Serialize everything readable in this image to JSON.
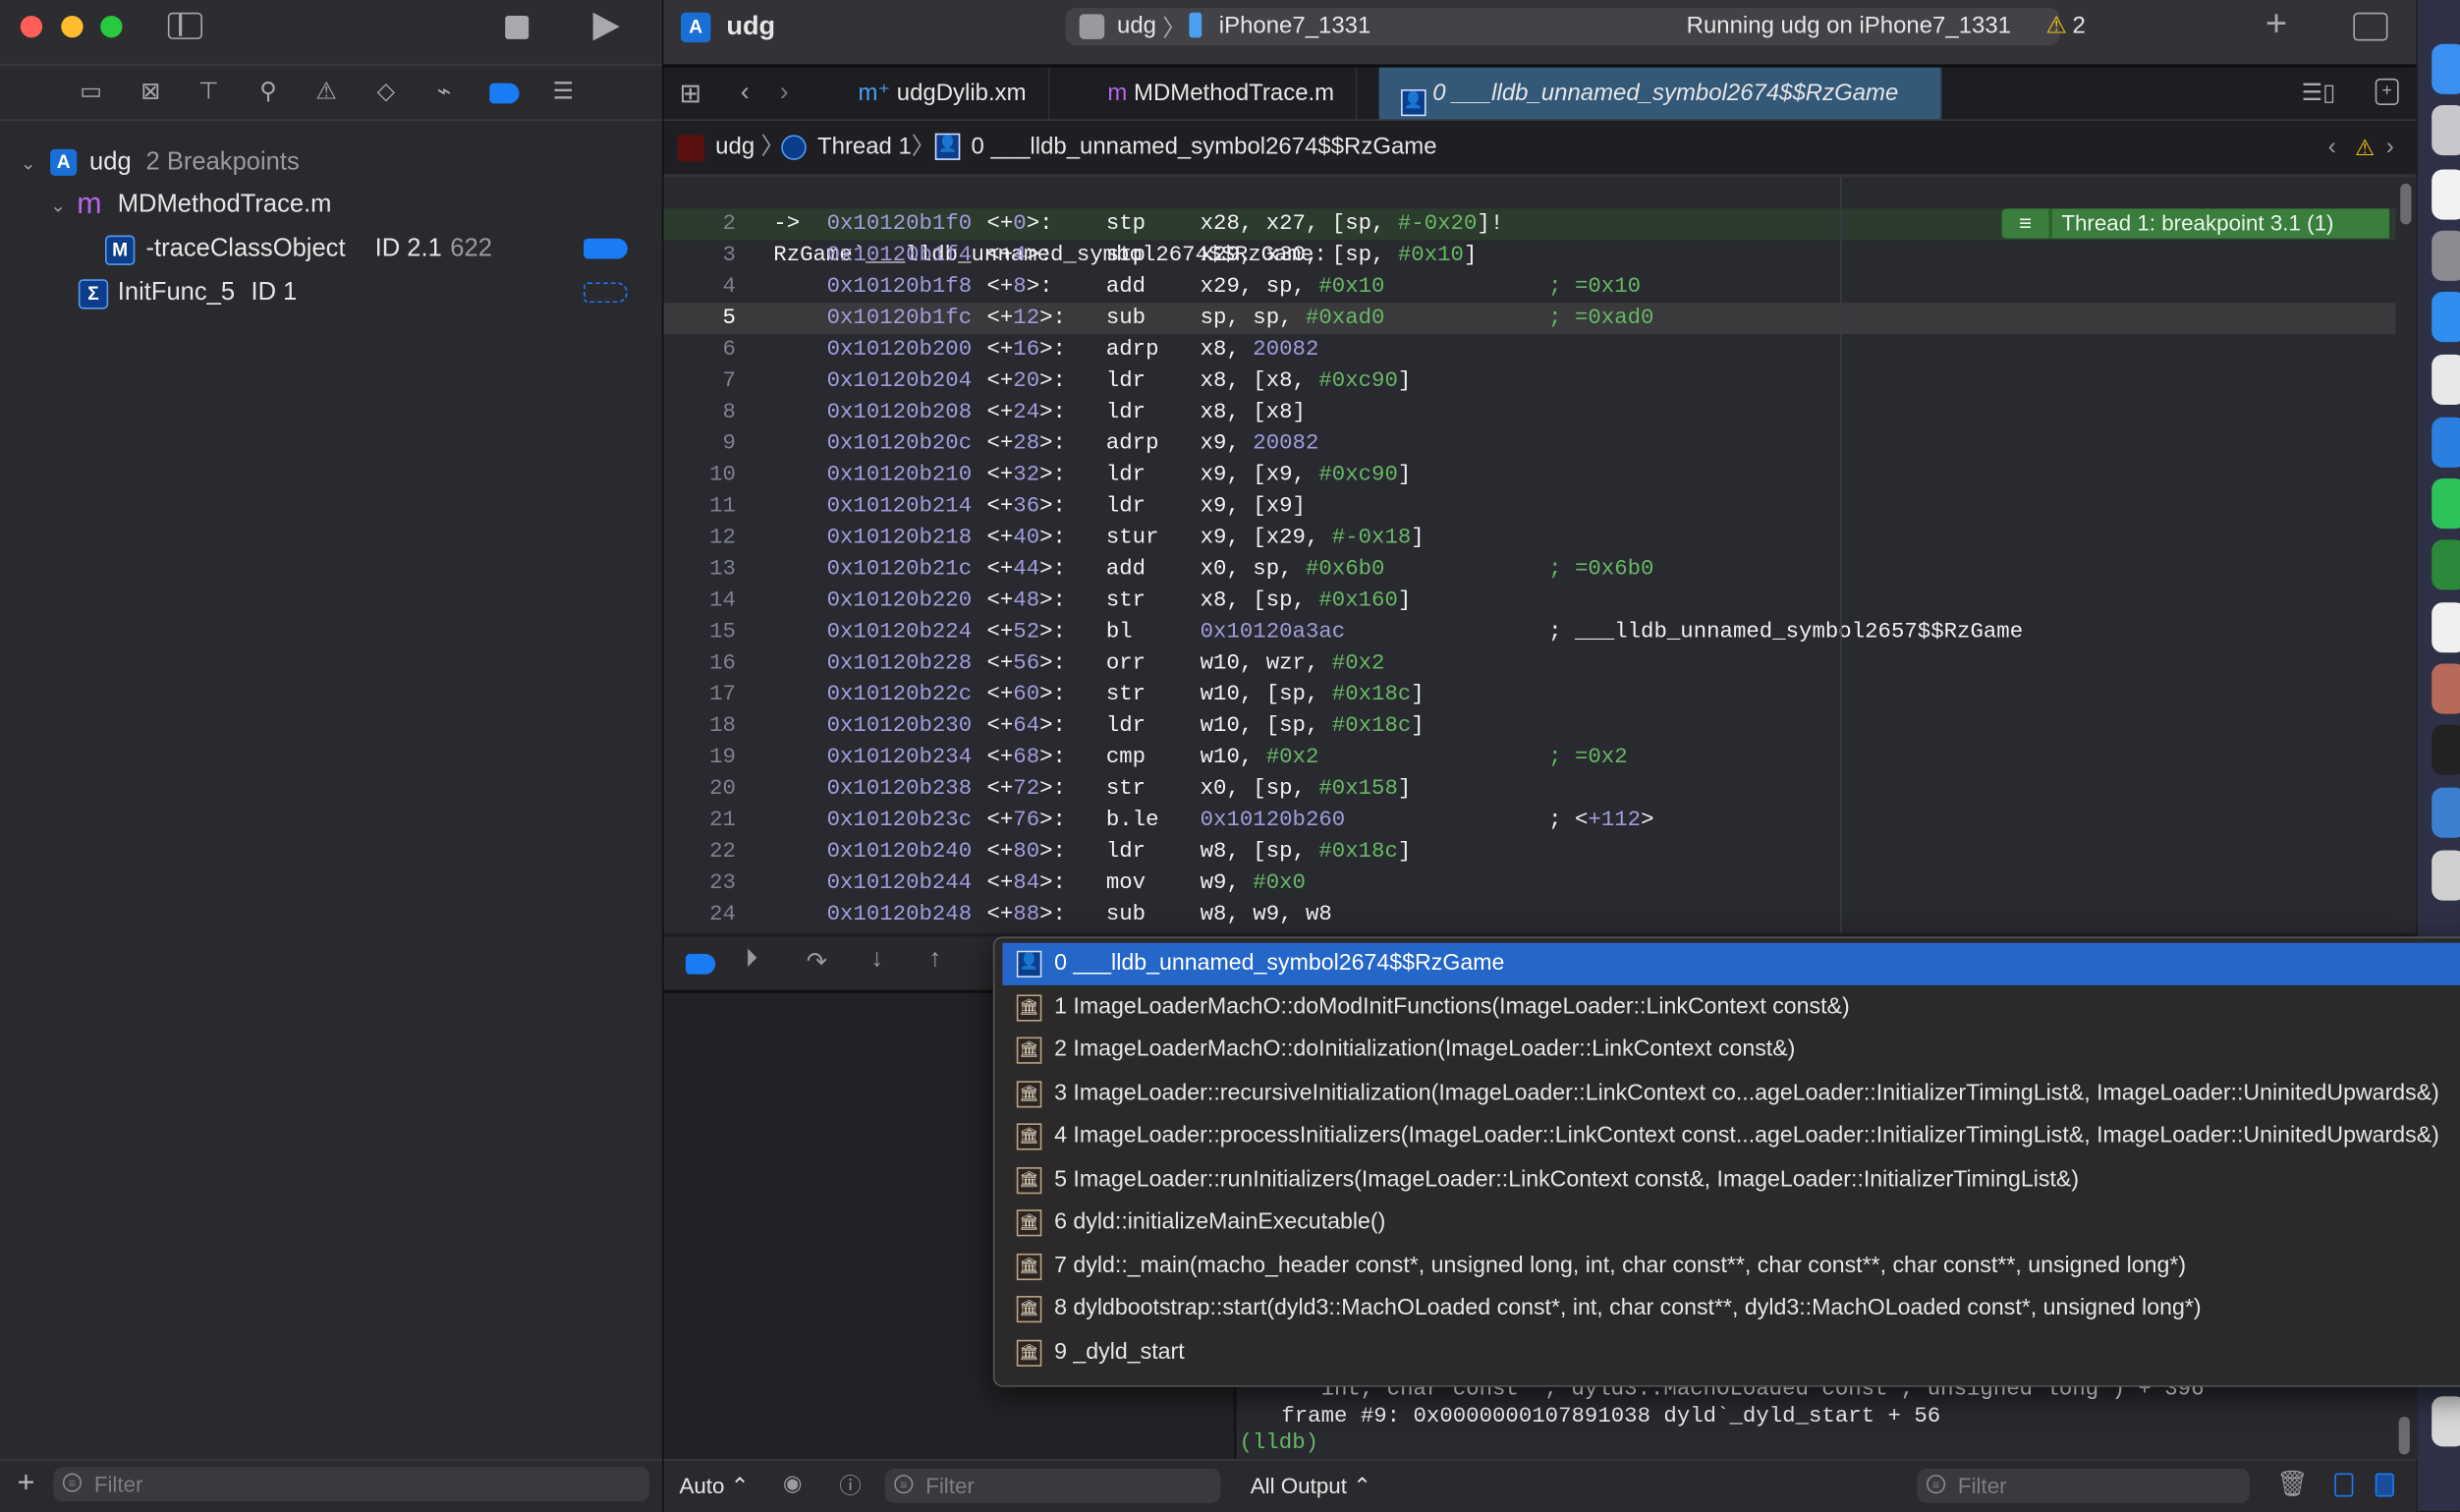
{
  "window": {
    "project_name": "udg",
    "scheme": "udg",
    "device": "iPhone7_1331",
    "status": "Running udg on iPhone7_1331",
    "warning_count": "2",
    "traffic_lights": {
      "close": "#ff5f57",
      "minimize": "#febc2e",
      "zoom": "#28c840"
    }
  },
  "navigator": {
    "icons": [
      "folder-icon",
      "source-control-icon",
      "symbol-icon",
      "search-icon",
      "issue-icon",
      "test-icon",
      "debug-icon",
      "breakpoint-icon",
      "report-icon"
    ],
    "root": {
      "name": "udg",
      "detail": "2 Breakpoints"
    },
    "file": {
      "name": "MDMethodTrace.m"
    },
    "breakpoints": [
      {
        "name": "-traceClassObject",
        "id": "ID 2.1",
        "line": "622",
        "enabled": true
      },
      {
        "name": "InitFunc_5",
        "id": "ID 1",
        "line": "",
        "enabled": false
      }
    ],
    "filter_placeholder": "Filter"
  },
  "tabs": [
    {
      "icon": "m+",
      "label": "udgDylib.xm",
      "active": false
    },
    {
      "icon": "m",
      "label": "MDMethodTrace.m",
      "active": false
    },
    {
      "icon": "frame",
      "label": "0 ___lldb_unnamed_symbol2674$$RzGame",
      "active": true
    }
  ],
  "breadcrumb": [
    "udg",
    "Thread 1",
    "0 ___lldb_unnamed_symbol2674$$RzGame"
  ],
  "code": {
    "header": "RzGame`___lldb_unnamed_symbol2674$$RzGame:",
    "current_line": 2,
    "highlight_line": 5,
    "breakpoint_annotation": "Thread 1: breakpoint 3.1 (1)",
    "lines": [
      {
        "n": "2",
        "arrow": "->",
        "addr": "0x10120b1f0",
        "off": "0",
        "mn": "stp",
        "ops": [
          [
            "x28, x27, [sp, ",
            "w"
          ],
          [
            "#-0x20",
            "imm"
          ],
          [
            "]!",
            "w"
          ]
        ],
        "cm": []
      },
      {
        "n": "3",
        "addr": "0x10120b1f4",
        "off": "4",
        "mn": "stp",
        "ops": [
          [
            "x29, x30, [sp, ",
            "w"
          ],
          [
            "#0x10",
            "imm"
          ],
          [
            "]",
            "w"
          ]
        ],
        "cm": []
      },
      {
        "n": "4",
        "addr": "0x10120b1f8",
        "off": "8",
        "mn": "add",
        "ops": [
          [
            "x29, sp, ",
            "w"
          ],
          [
            "#0x10",
            "imm"
          ]
        ],
        "cm": [
          [
            "; =0x10",
            "cm"
          ]
        ]
      },
      {
        "n": "5",
        "addr": "0x10120b1fc",
        "off": "12",
        "mn": "sub",
        "ops": [
          [
            "sp, sp, ",
            "w"
          ],
          [
            "#0xad0",
            "imm"
          ]
        ],
        "cm": [
          [
            "; =0xad0",
            "cm"
          ]
        ]
      },
      {
        "n": "6",
        "addr": "0x10120b200",
        "off": "16",
        "mn": "adrp",
        "ops": [
          [
            "x8, ",
            "w"
          ],
          [
            "20082",
            "num"
          ]
        ],
        "cm": []
      },
      {
        "n": "7",
        "addr": "0x10120b204",
        "off": "20",
        "mn": "ldr",
        "ops": [
          [
            "x8, [x8, ",
            "w"
          ],
          [
            "#0xc90",
            "imm"
          ],
          [
            "]",
            "w"
          ]
        ],
        "cm": []
      },
      {
        "n": "8",
        "addr": "0x10120b208",
        "off": "24",
        "mn": "ldr",
        "ops": [
          [
            "x8, [x8]",
            "w"
          ]
        ],
        "cm": []
      },
      {
        "n": "9",
        "addr": "0x10120b20c",
        "off": "28",
        "mn": "adrp",
        "ops": [
          [
            "x9, ",
            "w"
          ],
          [
            "20082",
            "num"
          ]
        ],
        "cm": []
      },
      {
        "n": "10",
        "addr": "0x10120b210",
        "off": "32",
        "mn": "ldr",
        "ops": [
          [
            "x9, [x9, ",
            "w"
          ],
          [
            "#0xc90",
            "imm"
          ],
          [
            "]",
            "w"
          ]
        ],
        "cm": []
      },
      {
        "n": "11",
        "addr": "0x10120b214",
        "off": "36",
        "mn": "ldr",
        "ops": [
          [
            "x9, [x9]",
            "w"
          ]
        ],
        "cm": []
      },
      {
        "n": "12",
        "addr": "0x10120b218",
        "off": "40",
        "mn": "stur",
        "ops": [
          [
            "x9, [x29, ",
            "w"
          ],
          [
            "#-0x18",
            "imm"
          ],
          [
            "]",
            "w"
          ]
        ],
        "cm": []
      },
      {
        "n": "13",
        "addr": "0x10120b21c",
        "off": "44",
        "mn": "add",
        "ops": [
          [
            "x0, sp, ",
            "w"
          ],
          [
            "#0x6b0",
            "imm"
          ]
        ],
        "cm": [
          [
            "; =0x6b0",
            "cm"
          ]
        ]
      },
      {
        "n": "14",
        "addr": "0x10120b220",
        "off": "48",
        "mn": "str",
        "ops": [
          [
            "x8, [sp, ",
            "w"
          ],
          [
            "#0x160",
            "imm"
          ],
          [
            "]",
            "w"
          ]
        ],
        "cm": []
      },
      {
        "n": "15",
        "addr": "0x10120b224",
        "off": "52",
        "mn": "bl",
        "ops": [
          [
            "0x10120a3ac",
            "num"
          ]
        ],
        "cm": [
          [
            "; ___lldb_unnamed_symbol2657$$RzGame",
            "w"
          ]
        ]
      },
      {
        "n": "16",
        "addr": "0x10120b228",
        "off": "56",
        "mn": "orr",
        "ops": [
          [
            "w10, wzr, ",
            "w"
          ],
          [
            "#0x2",
            "imm"
          ]
        ],
        "cm": []
      },
      {
        "n": "17",
        "addr": "0x10120b22c",
        "off": "60",
        "mn": "str",
        "ops": [
          [
            "w10, [sp, ",
            "w"
          ],
          [
            "#0x18c",
            "imm"
          ],
          [
            "]",
            "w"
          ]
        ],
        "cm": []
      },
      {
        "n": "18",
        "addr": "0x10120b230",
        "off": "64",
        "mn": "ldr",
        "ops": [
          [
            "w10, [sp, ",
            "w"
          ],
          [
            "#0x18c",
            "imm"
          ],
          [
            "]",
            "w"
          ]
        ],
        "cm": []
      },
      {
        "n": "19",
        "addr": "0x10120b234",
        "off": "68",
        "mn": "cmp",
        "ops": [
          [
            "w10, ",
            "w"
          ],
          [
            "#0x2",
            "imm"
          ]
        ],
        "cm": [
          [
            "; =0x2",
            "cm"
          ]
        ]
      },
      {
        "n": "20",
        "addr": "0x10120b238",
        "off": "72",
        "mn": "str",
        "ops": [
          [
            "x0, [sp, ",
            "w"
          ],
          [
            "#0x158",
            "imm"
          ],
          [
            "]",
            "w"
          ]
        ],
        "cm": []
      },
      {
        "n": "21",
        "addr": "0x10120b23c",
        "off": "76",
        "mn": "b.le",
        "ops": [
          [
            "0x10120b260",
            "num"
          ]
        ],
        "cm": [
          [
            "; <",
            "w"
          ],
          [
            "+112",
            "num"
          ],
          [
            ">",
            "w"
          ]
        ]
      },
      {
        "n": "22",
        "addr": "0x10120b240",
        "off": "80",
        "mn": "ldr",
        "ops": [
          [
            "w8, [sp, ",
            "w"
          ],
          [
            "#0x18c",
            "imm"
          ],
          [
            "]",
            "w"
          ]
        ],
        "cm": []
      },
      {
        "n": "23",
        "addr": "0x10120b244",
        "off": "84",
        "mn": "mov",
        "ops": [
          [
            "w9, ",
            "w"
          ],
          [
            "#0x0",
            "imm"
          ]
        ],
        "cm": []
      },
      {
        "n": "24",
        "addr": "0x10120b248",
        "off": "88",
        "mn": "sub",
        "ops": [
          [
            "w8, w9, w8",
            "w"
          ]
        ],
        "cm": []
      }
    ]
  },
  "stack_frames": [
    "0 ___lldb_unnamed_symbol2674$$RzGame",
    "1 ImageLoaderMachO::doModInitFunctions(ImageLoader::LinkContext const&)",
    "2 ImageLoaderMachO::doInitialization(ImageLoader::LinkContext const&)",
    "3 ImageLoader::recursiveInitialization(ImageLoader::LinkContext co...ageLoader::InitializerTimingList&, ImageLoader::UninitedUpwards&)",
    "4 ImageLoader::processInitializers(ImageLoader::LinkContext const...ageLoader::InitializerTimingList&, ImageLoader::UninitedUpwards&)",
    "5 ImageLoader::runInitializers(ImageLoader::LinkContext const&, ImageLoader::InitializerTimingList&)",
    "6 dyld::initializeMainExecutable()",
    "7 dyld::_main(macho_header const*, unsigned long, int, char const**, char const**, char const**, unsigned long*)",
    "8 dyldbootstrap::start(dyld3::MachOLoaded const*, int, char const**, dyld3::MachOLoaded const*, unsigned long*)",
    "9 _dyld_start"
  ],
  "console": {
    "lines": [
      "     int, char const**, dyld3::MachOLoaded const*, unsigned long*) + 396",
      "  frame #9: 0x0000000107891038 dyld`_dyld_start + 56"
    ],
    "prompt": "(lldb)"
  },
  "bottom": {
    "variables_scope": "Auto ⌃",
    "variables_filter_placeholder": "Filter",
    "output_scope": "All Output ⌃",
    "console_filter_placeholder": "Filter"
  }
}
